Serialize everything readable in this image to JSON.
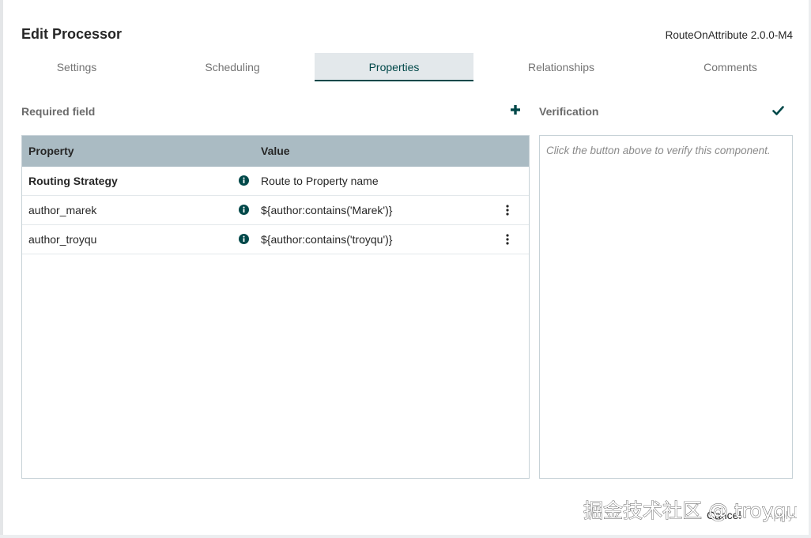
{
  "dialog": {
    "title": "Edit Processor",
    "subtitle": "RouteOnAttribute 2.0.0-M4"
  },
  "tabs": [
    {
      "label": "Settings",
      "active": false
    },
    {
      "label": "Scheduling",
      "active": false
    },
    {
      "label": "Properties",
      "active": true
    },
    {
      "label": "Relationships",
      "active": false
    },
    {
      "label": "Comments",
      "active": false
    }
  ],
  "properties": {
    "required_label": "Required field",
    "add_icon": "plus-icon",
    "columns": {
      "property": "Property",
      "value": "Value"
    },
    "rows": [
      {
        "name": "Routing Strategy",
        "value": "Route to Property name",
        "required": true,
        "has_menu": false
      },
      {
        "name": "author_marek",
        "value": "${author:contains('Marek')}",
        "required": false,
        "has_menu": true
      },
      {
        "name": "author_troyqu",
        "value": "${author:contains('troyqu')}",
        "required": false,
        "has_menu": true
      }
    ]
  },
  "verification": {
    "label": "Verification",
    "icon": "checkmark-icon",
    "message": "Click the button above to verify this component."
  },
  "footer": {
    "cancel_label": "Cancel",
    "apply_label": "Apply"
  },
  "watermark": {
    "text": "掘金技术社区 @ troyqu"
  },
  "colors": {
    "accent": "#004849",
    "tab_active_bg": "#e3e8eb",
    "table_header_bg": "#aabbc3",
    "border": "#c7d2d7",
    "muted_text": "#737373"
  }
}
